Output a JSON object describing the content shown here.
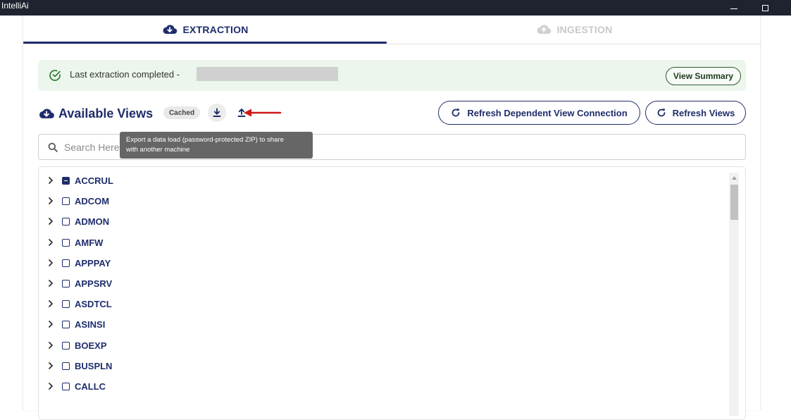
{
  "window": {
    "title": "IntelliAi"
  },
  "tabs": [
    {
      "label": "EXTRACTION",
      "active": true
    },
    {
      "label": "INGESTION",
      "active": false
    }
  ],
  "status": {
    "text": "Last extraction completed -",
    "view_summary_label": "View Summary"
  },
  "views": {
    "title": "Available Views",
    "cached_label": "Cached",
    "refresh_dependent_label": "Refresh Dependent View Connection",
    "refresh_views_label": "Refresh Views"
  },
  "tooltip": {
    "line1": "Export a data load (password-protected ZIP) to share",
    "line2": "with another machine"
  },
  "search": {
    "placeholder": "Search Here"
  },
  "list": {
    "items": [
      {
        "label": "ACCRUL",
        "state": "indeterminate"
      },
      {
        "label": "ADCOM",
        "state": "unchecked"
      },
      {
        "label": "ADMON",
        "state": "unchecked"
      },
      {
        "label": "AMFW",
        "state": "unchecked"
      },
      {
        "label": "APPPAY",
        "state": "unchecked"
      },
      {
        "label": "APPSRV",
        "state": "unchecked"
      },
      {
        "label": "ASDTCL",
        "state": "unchecked"
      },
      {
        "label": "ASINSI",
        "state": "unchecked"
      },
      {
        "label": "BOEXP",
        "state": "unchecked"
      },
      {
        "label": "BUSPLN",
        "state": "unchecked"
      },
      {
        "label": "CALLC",
        "state": "unchecked"
      }
    ]
  },
  "colors": {
    "primary": "#1f2d6b",
    "success_bg": "#ecf6ec",
    "success_icon": "#2e7d32",
    "annotation_arrow": "#d01818"
  }
}
